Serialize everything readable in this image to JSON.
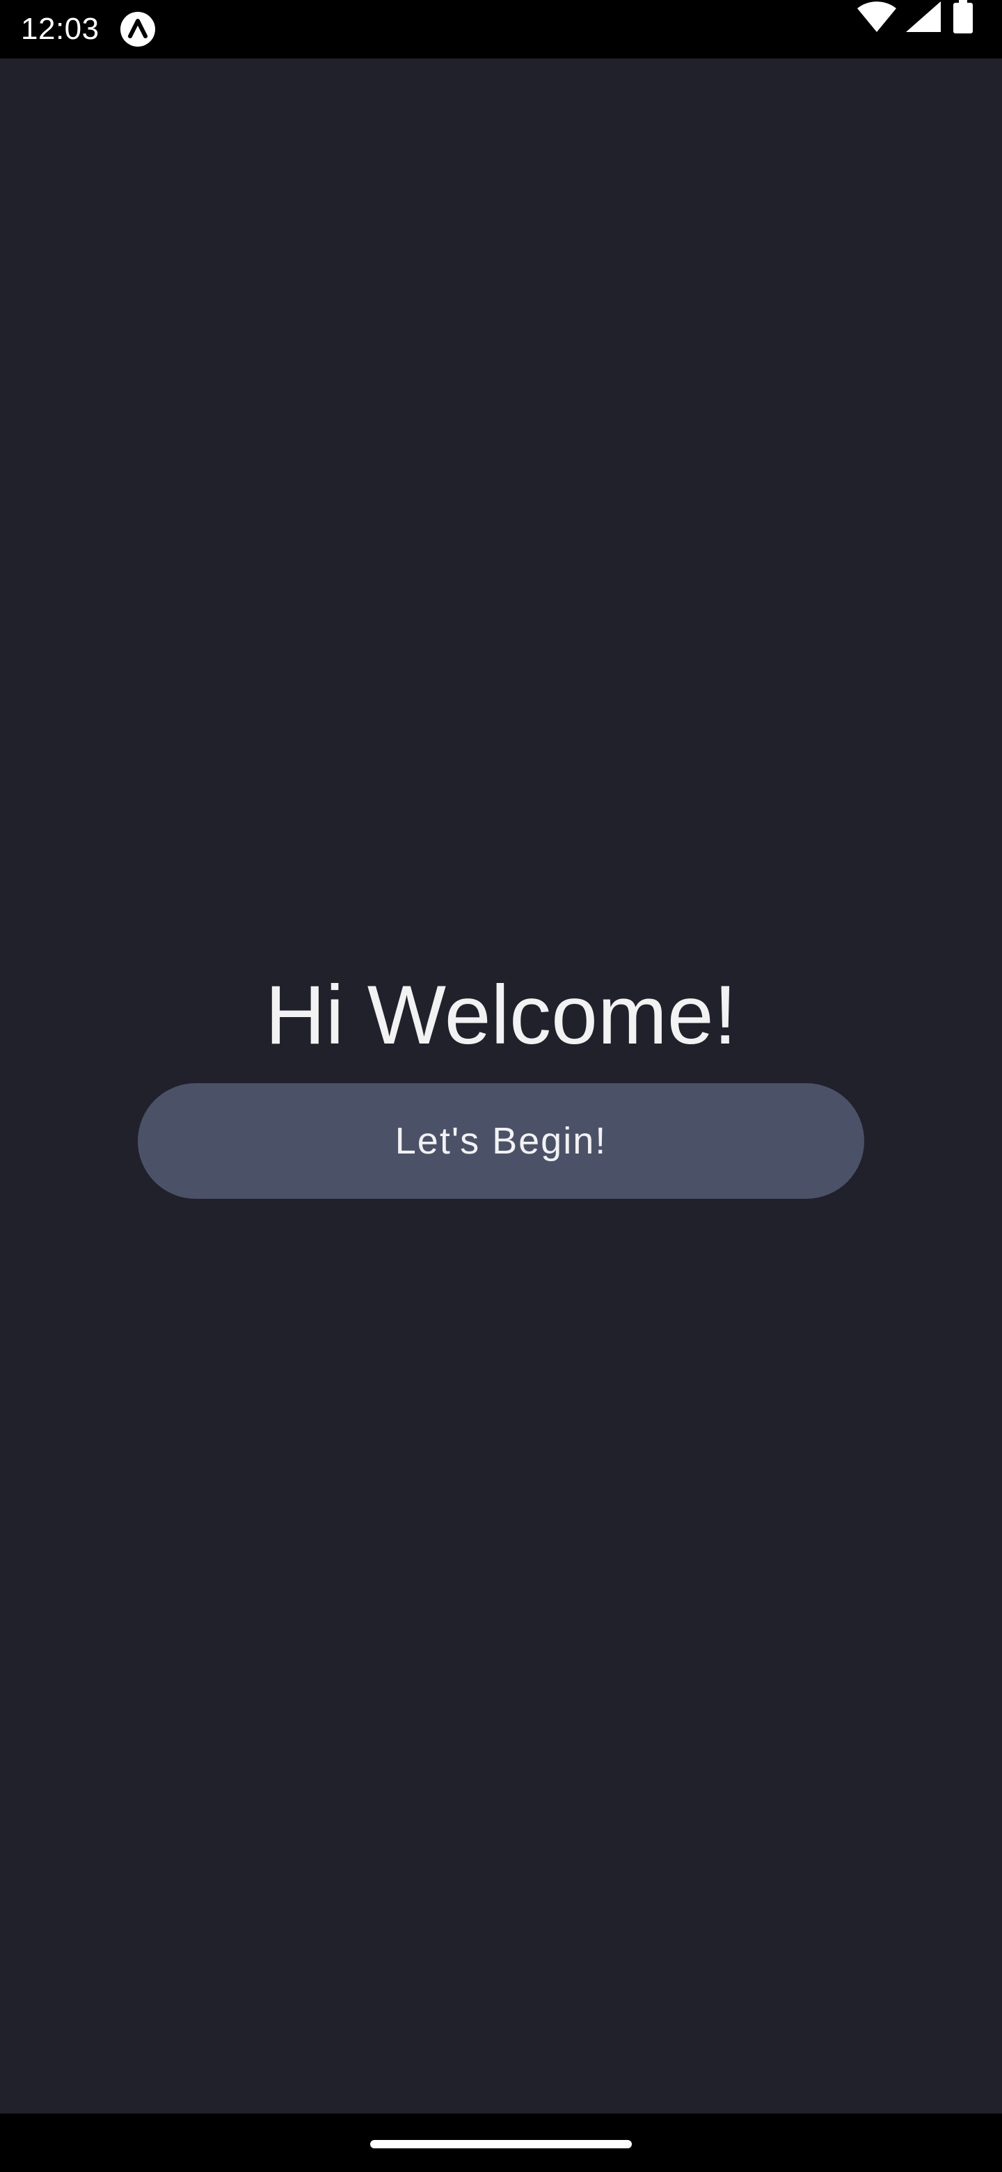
{
  "status_bar": {
    "time": "12:03",
    "icons": [
      "app-notification-icon",
      "wifi-icon",
      "signal-icon",
      "battery-icon"
    ]
  },
  "main": {
    "title": "Hi Welcome!",
    "begin_button_label": "Let's Begin!"
  },
  "colors": {
    "background": "#21212c",
    "button": "#4b5268",
    "text": "#f2f2f2",
    "system_bars": "#000000"
  }
}
